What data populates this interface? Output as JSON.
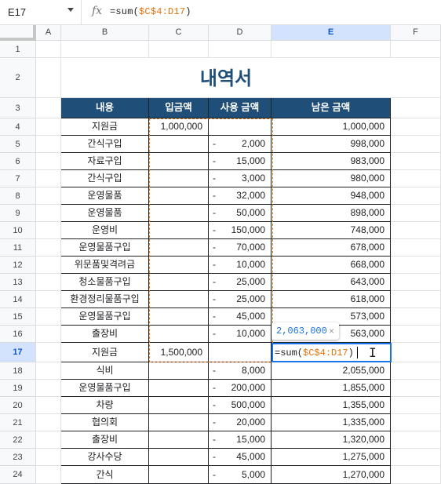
{
  "formula_bar": {
    "cell_ref": "E17",
    "fx": "fx",
    "formula_prefix": "=sum(",
    "formula_range": "$C$4:D17",
    "formula_suffix": ")"
  },
  "columns": [
    "",
    "A",
    "B",
    "C",
    "D",
    "E",
    "F"
  ],
  "rows": [
    "1",
    "2",
    "3",
    "4",
    "5",
    "6",
    "7",
    "8",
    "9",
    "10",
    "11",
    "12",
    "13",
    "14",
    "15",
    "16",
    "17",
    "18",
    "19",
    "20",
    "21",
    "22",
    "23",
    "24"
  ],
  "title": "내역서",
  "table_headers": [
    "내용",
    "입금액",
    "사용 금액",
    "남은 금액"
  ],
  "table_rows": [
    {
      "item": "지원금",
      "deposit": "1,000,000",
      "minus": "",
      "spent": "",
      "balance": "1,000,000"
    },
    {
      "item": "간식구입",
      "deposit": "",
      "minus": "-",
      "spent": "2,000",
      "balance": "998,000"
    },
    {
      "item": "자료구입",
      "deposit": "",
      "minus": "-",
      "spent": "15,000",
      "balance": "983,000"
    },
    {
      "item": "간식구입",
      "deposit": "",
      "minus": "-",
      "spent": "3,000",
      "balance": "980,000"
    },
    {
      "item": "운영물품",
      "deposit": "",
      "minus": "-",
      "spent": "32,000",
      "balance": "948,000"
    },
    {
      "item": "운영물품",
      "deposit": "",
      "minus": "-",
      "spent": "50,000",
      "balance": "898,000"
    },
    {
      "item": "운영비",
      "deposit": "",
      "minus": "-",
      "spent": "150,000",
      "balance": "748,000"
    },
    {
      "item": "운영물품구입",
      "deposit": "",
      "minus": "-",
      "spent": "70,000",
      "balance": "678,000"
    },
    {
      "item": "위문품및격려금",
      "deposit": "",
      "minus": "-",
      "spent": "10,000",
      "balance": "668,000"
    },
    {
      "item": "청소물품구입",
      "deposit": "",
      "minus": "-",
      "spent": "25,000",
      "balance": "643,000"
    },
    {
      "item": "환경정리물품구입",
      "deposit": "",
      "minus": "-",
      "spent": "25,000",
      "balance": "618,000"
    },
    {
      "item": "운영물품구입",
      "deposit": "",
      "minus": "-",
      "spent": "45,000",
      "balance": "573,000"
    },
    {
      "item": "출장비",
      "deposit": "",
      "minus": "-",
      "spent": "10,000",
      "balance": "563,000"
    },
    {
      "item": "지원금",
      "deposit": "1,500,000",
      "minus": "",
      "spent": "",
      "balance": ""
    },
    {
      "item": "식비",
      "deposit": "",
      "minus": "-",
      "spent": "8,000",
      "balance": "2,055,000"
    },
    {
      "item": "운영물품구입",
      "deposit": "",
      "minus": "-",
      "spent": "200,000",
      "balance": "1,855,000"
    },
    {
      "item": "차량",
      "deposit": "",
      "minus": "-",
      "spent": "500,000",
      "balance": "1,355,000"
    },
    {
      "item": "협의회",
      "deposit": "",
      "minus": "-",
      "spent": "20,000",
      "balance": "1,335,000"
    },
    {
      "item": "출장비",
      "deposit": "",
      "minus": "-",
      "spent": "15,000",
      "balance": "1,320,000"
    },
    {
      "item": "강사수당",
      "deposit": "",
      "minus": "-",
      "spent": "45,000",
      "balance": "1,275,000"
    },
    {
      "item": "간식",
      "deposit": "",
      "minus": "-",
      "spent": "5,000",
      "balance": "1,270,000"
    }
  ],
  "tooltip": {
    "value": "2,063,000",
    "close": "×"
  },
  "colors": {
    "header_bg": "#1f4e79",
    "title": "#1f4e79",
    "range": "#e8710a",
    "selection": "#1a73e8"
  }
}
